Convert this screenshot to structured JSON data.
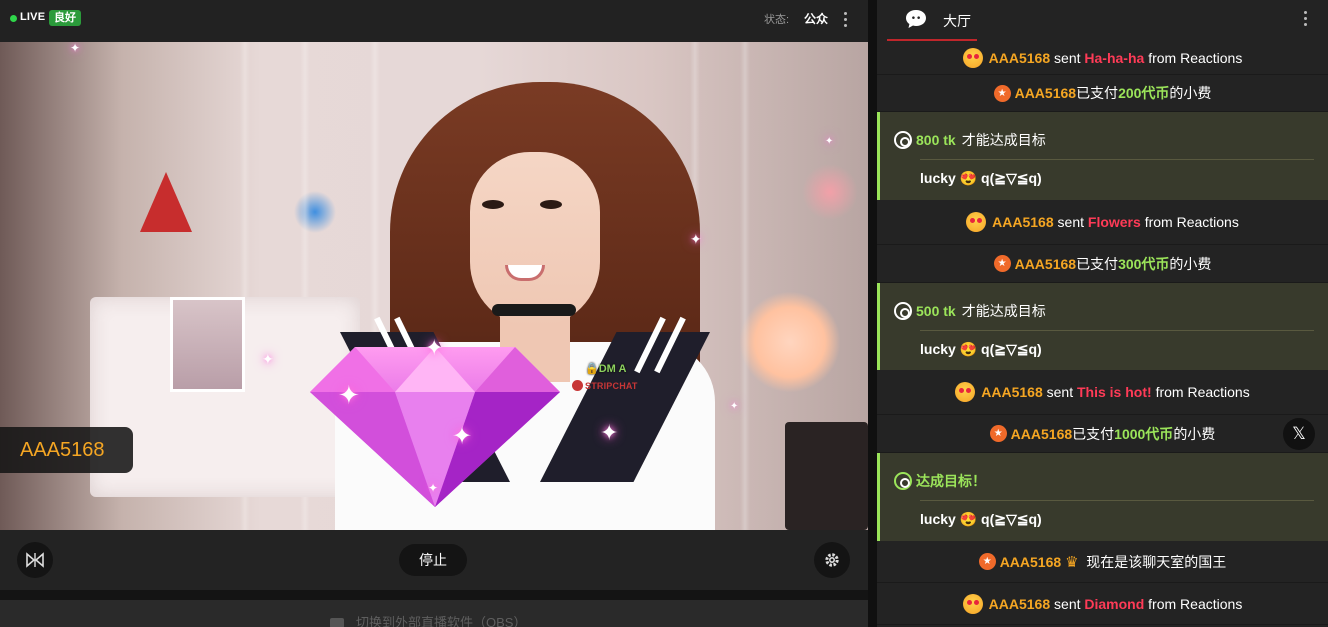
{
  "header": {
    "live_label": "LIVE",
    "quality": "良好",
    "status_label": "状态:",
    "status_value": "公众"
  },
  "video": {
    "watermark_top": "DM A",
    "watermark_bottom": "STRIPCHAT",
    "tipper_overlay": "AAA5168"
  },
  "controls": {
    "stop_label": "停止",
    "obs_label": "切换到外部直播软件（OBS）"
  },
  "chat": {
    "tab_label": "大厅",
    "messages": [
      {
        "user": "AAA5168",
        "pre": "sent",
        "item": "Ha-ha-ha",
        "post": "from Reactions"
      },
      {
        "user": "AAA5168",
        "pre": "已支付",
        "coins": "200代币",
        "post": "的小费"
      },
      {
        "user": "AAA5168",
        "pre": "sent",
        "item": "Flowers",
        "post": "from Reactions"
      },
      {
        "user": "AAA5168",
        "pre": "已支付",
        "coins": "300代币",
        "post": "的小费"
      },
      {
        "user": "AAA5168",
        "pre": "sent",
        "item": "This is hot!",
        "post": "from Reactions"
      },
      {
        "user": "AAA5168",
        "pre": "已支付",
        "coins": "1000代币",
        "post": "的小费"
      },
      {
        "user": "AAA5168",
        "post": "现在是该聊天室的国王"
      },
      {
        "user": "AAA5168",
        "pre": "sent",
        "item": "Diamond",
        "post": "from Reactions"
      }
    ],
    "goals": [
      {
        "amount": "800 tk",
        "text": "才能达成目标",
        "note": "lucky 😍 q(≧▽≦q)"
      },
      {
        "amount": "500 tk",
        "text": "才能达成目标",
        "note": "lucky 😍 q(≧▽≦q)"
      },
      {
        "amount": "达成目标！",
        "text": "",
        "note": "lucky 😍 q(≧▽≦q)"
      }
    ],
    "x_button": "𝕏"
  },
  "colors": {
    "accent": "#c0262b",
    "username": "#f5a623",
    "reaction": "#ff3b57",
    "coins": "#9be45a",
    "live_dot": "#2fd64a"
  }
}
